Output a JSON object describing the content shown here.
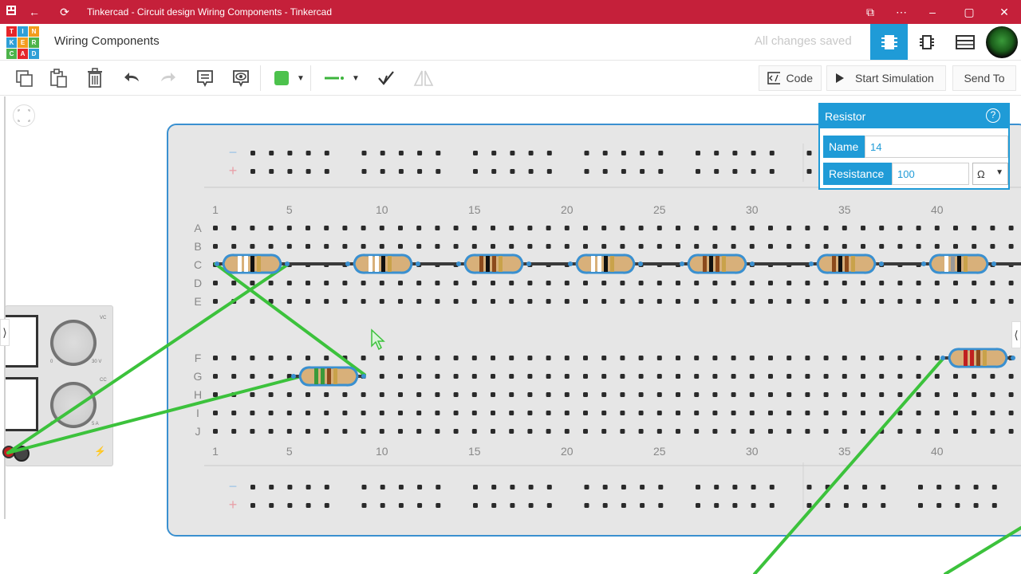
{
  "window": {
    "title": "Tinkercad - Circuit design Wiring Components - Tinkercad"
  },
  "logo": {
    "letters": [
      "TIN",
      "KER",
      "CAD"
    ]
  },
  "header": {
    "doc_title": "Wiring Components",
    "save_status": "All changes saved"
  },
  "toolbar": {
    "code_label": "Code",
    "simulate_label": "Start Simulation",
    "send_label": "Send To",
    "wire_color": "#4cc24c"
  },
  "breadboard": {
    "col_labels": [
      "1",
      "5",
      "10",
      "15",
      "20",
      "25",
      "30",
      "35",
      "40"
    ],
    "row_labels_top": [
      "A",
      "B",
      "C",
      "D",
      "E"
    ],
    "row_labels_bottom": [
      "F",
      "G",
      "H",
      "I",
      "J"
    ],
    "rail_minus": "−",
    "rail_plus": "+"
  },
  "inspector": {
    "title": "Resistor",
    "name_label": "Name",
    "name_value": "14",
    "resistance_label": "Resistance",
    "resistance_value": "100",
    "unit": "Ω"
  },
  "power_supply": {
    "vc_label": "VC",
    "cc_label": "CC",
    "v_max": "30 V",
    "v_min": "0",
    "a_max": "5 A",
    "a_min": "0"
  },
  "colors": {
    "titlebar": "#c5203a",
    "accent": "#1f9bd7",
    "wire": "#3cc23c",
    "breadboard": "#e6e6e6"
  }
}
